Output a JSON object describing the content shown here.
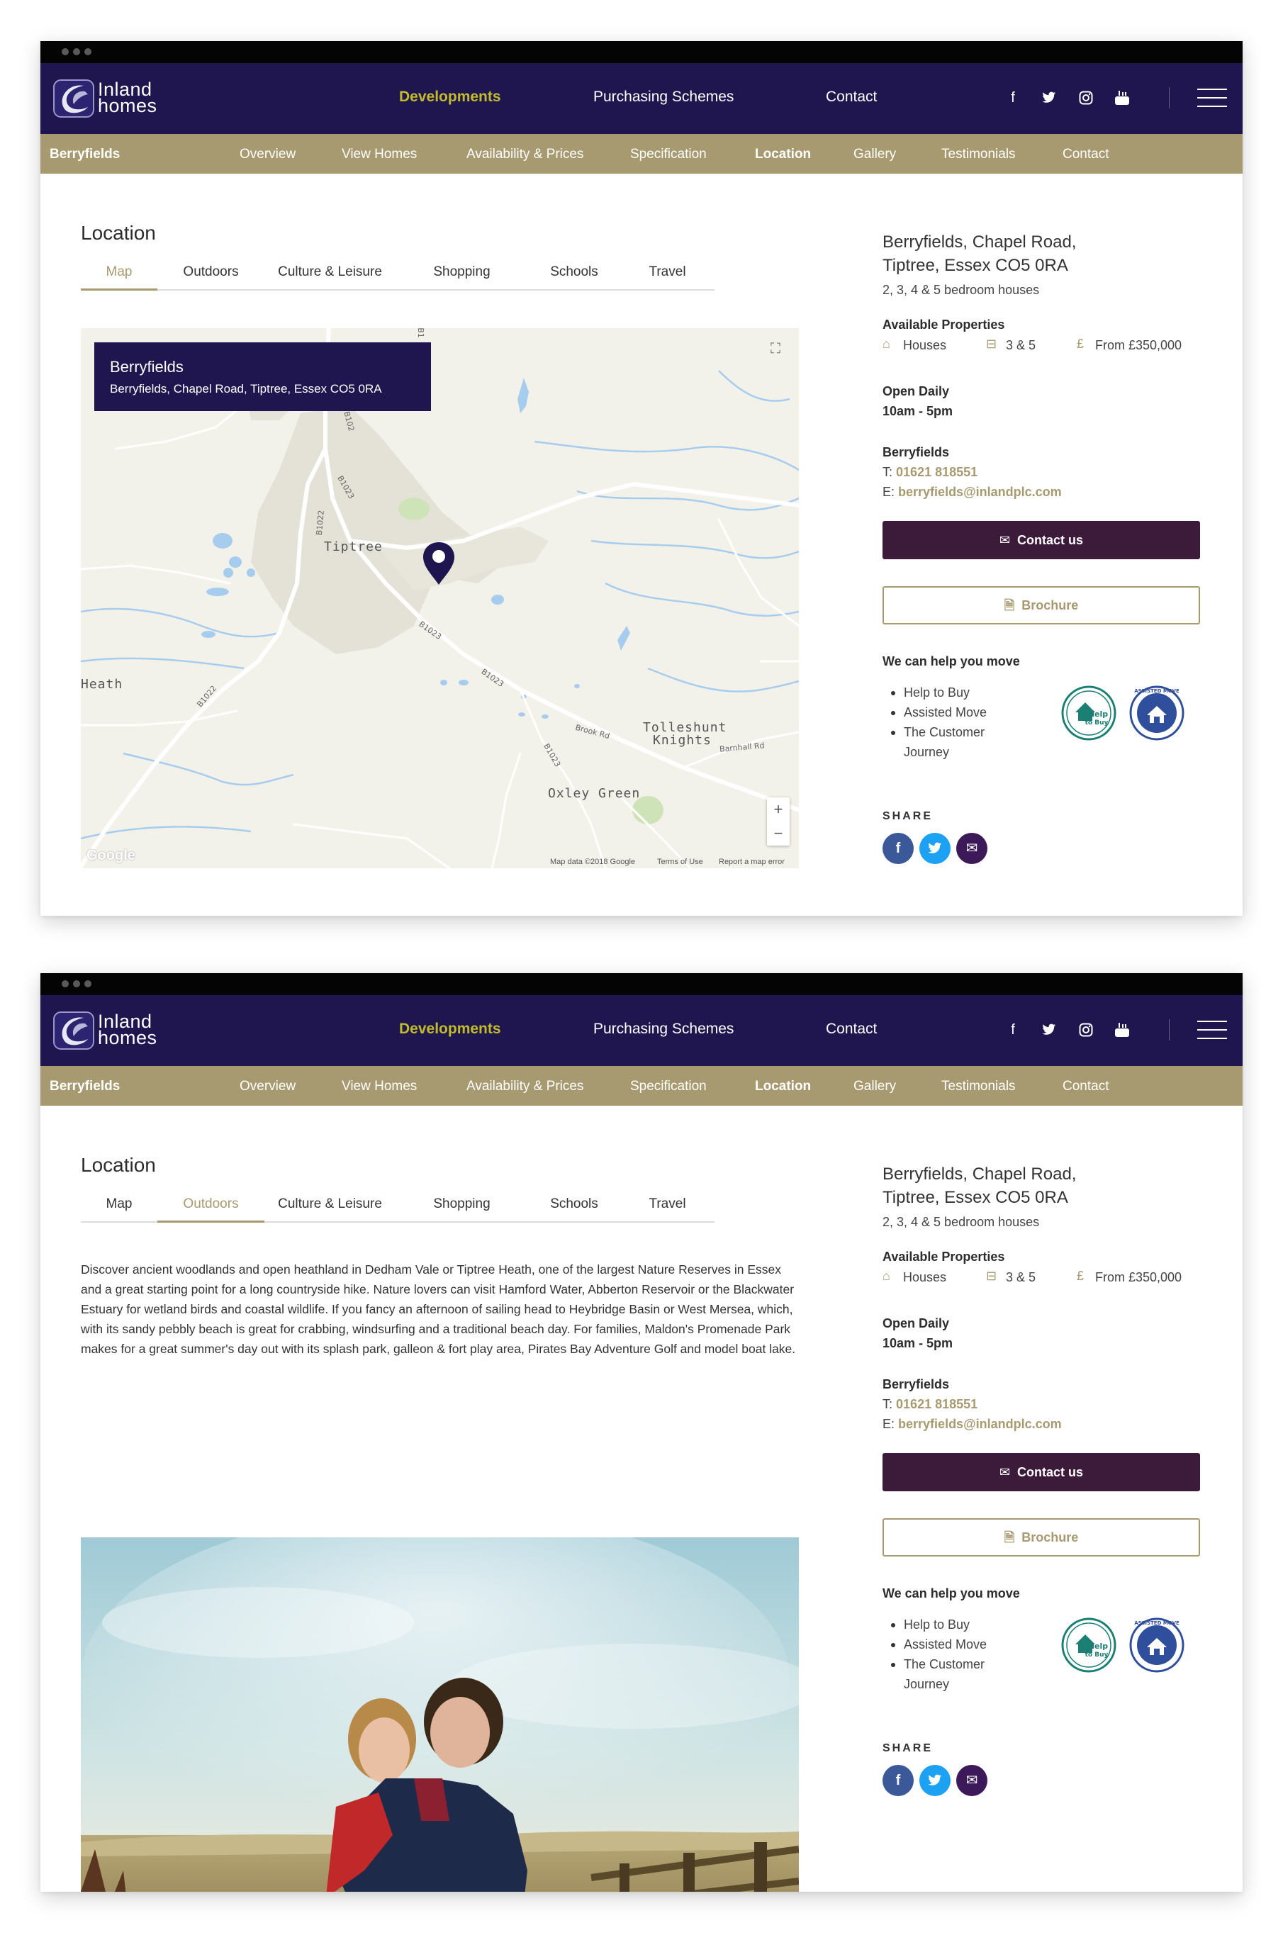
{
  "header": {
    "logo_line1": "Inland",
    "logo_line2": "homes",
    "nav": [
      "Developments",
      "Purchasing Schemes",
      "Contact"
    ],
    "social_icons": [
      "facebook-icon",
      "twitter-icon",
      "instagram-icon",
      "youtube-icon"
    ]
  },
  "subnav": {
    "brand": "Berryfields",
    "items": [
      "Overview",
      "View Homes",
      "Availability & Prices",
      "Specification",
      "Location",
      "Gallery",
      "Testimonials",
      "Contact"
    ],
    "active": "Location"
  },
  "location": {
    "title": "Location",
    "tabs": [
      "Map",
      "Outdoors",
      "Culture & Leisure",
      "Shopping",
      "Schools",
      "Travel"
    ]
  },
  "map": {
    "infobox_title": "Berryfields",
    "infobox_address": "Berryfields, Chapel Road, Tiptree, Essex CO5 0RA",
    "places": [
      "Tiptree",
      "Heath",
      "Tolleshunt",
      "Knights",
      "Oxley Green"
    ],
    "roads": [
      "B1",
      "B102",
      "B1023",
      "B1022",
      "B1023",
      "B1023",
      "B1022",
      "Brook Rd",
      "B1023",
      "Barnhall Rd"
    ],
    "zoom_in": "+",
    "zoom_out": "−",
    "fullscreen": "⛶",
    "google": "Google",
    "footer": [
      "Map data ©2018 Google",
      "Terms of Use",
      "Report a map error"
    ]
  },
  "outdoors_text": "Discover ancient woodlands and open heathland in Dedham Vale or Tiptree Heath, one of the largest Nature Reserves in Essex and a great starting point for a long countryside hike. Nature lovers can visit Hamford Water, Abberton Reservoir or the Blackwater Estuary for wetland birds and coastal wildlife. If you fancy an afternoon of sailing head to Heybridge Basin or West Mersea, which, with its sandy pebbly beach is great for crabbing, windsurfing and a traditional beach day. For families, Maldon's Promenade Park makes for a great summer's day out with its splash park, galleon & fort play area, Pirates Bay Adventure Golf and model boat lake.",
  "sidebar": {
    "address_line1": "Berryfields, Chapel Road,",
    "address_line2": "Tiptree, Essex CO5 0RA",
    "bedrooms": "2, 3, 4 & 5 bedroom houses",
    "available_heading": "Available Properties",
    "prop_type": "Houses",
    "prop_beds": "3 & 5",
    "prop_price": "From £350,000",
    "open_heading": "Open Daily",
    "open_hours": "10am - 5pm",
    "contact_name": "Berryfields",
    "phone_prefix": "T:",
    "phone": "01621 818551",
    "email_prefix": "E:",
    "email": "berryfields@inlandplc.com",
    "contact_button": "Contact us",
    "brochure_button": "Brochure",
    "help_heading": "We can help you move",
    "help_items": [
      "Help to Buy",
      "Assisted Move",
      "The Customer Journey"
    ],
    "badge1_text": "Help to Buy",
    "badge2_text": "ASSISTED MOVE",
    "share_label": "SHARE",
    "share_icons": [
      "facebook-icon",
      "twitter-icon",
      "email-icon"
    ]
  },
  "colors": {
    "nav_bg": "#1f1650",
    "subnav_bg": "#a89a70",
    "accent_gold": "#a89a70",
    "active_nav": "#c0bb28",
    "contact_btn": "#3c1a3a",
    "facebook": "#3b5998",
    "twitter": "#1da1f2",
    "email": "#3c1a5a"
  }
}
